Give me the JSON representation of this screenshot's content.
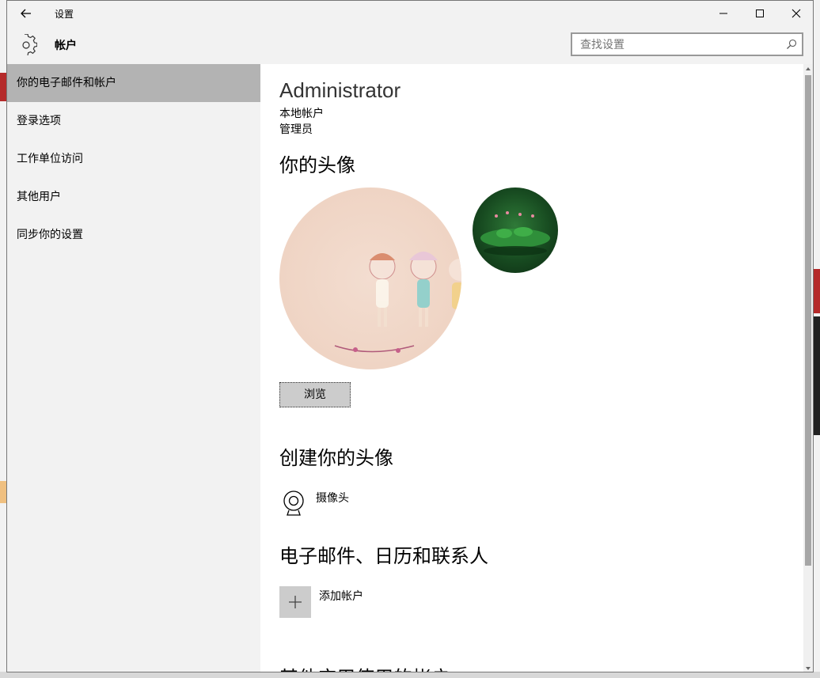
{
  "window": {
    "title": "设置",
    "section_title": "帐户"
  },
  "search": {
    "placeholder": "查找设置"
  },
  "sidebar": {
    "items": [
      {
        "label": "你的电子邮件和帐户"
      },
      {
        "label": "登录选项"
      },
      {
        "label": "工作单位访问"
      },
      {
        "label": "其他用户"
      },
      {
        "label": "同步你的设置"
      }
    ],
    "active_index": 0
  },
  "account": {
    "name": "Administrator",
    "type": "本地帐户",
    "role": "管理员"
  },
  "avatar_section": {
    "title": "你的头像",
    "browse_label": "浏览"
  },
  "create_avatar": {
    "title": "创建你的头像",
    "camera_label": "摄像头"
  },
  "email_section": {
    "title": "电子邮件、日历和联系人",
    "add_account_label": "添加帐户"
  },
  "other_apps": {
    "title": "其他应用使用的帐户"
  },
  "colors": {
    "sidebar_bg": "#f2f2f2",
    "active_item_bg": "#b3b3b3",
    "button_bg": "#cccccc"
  }
}
